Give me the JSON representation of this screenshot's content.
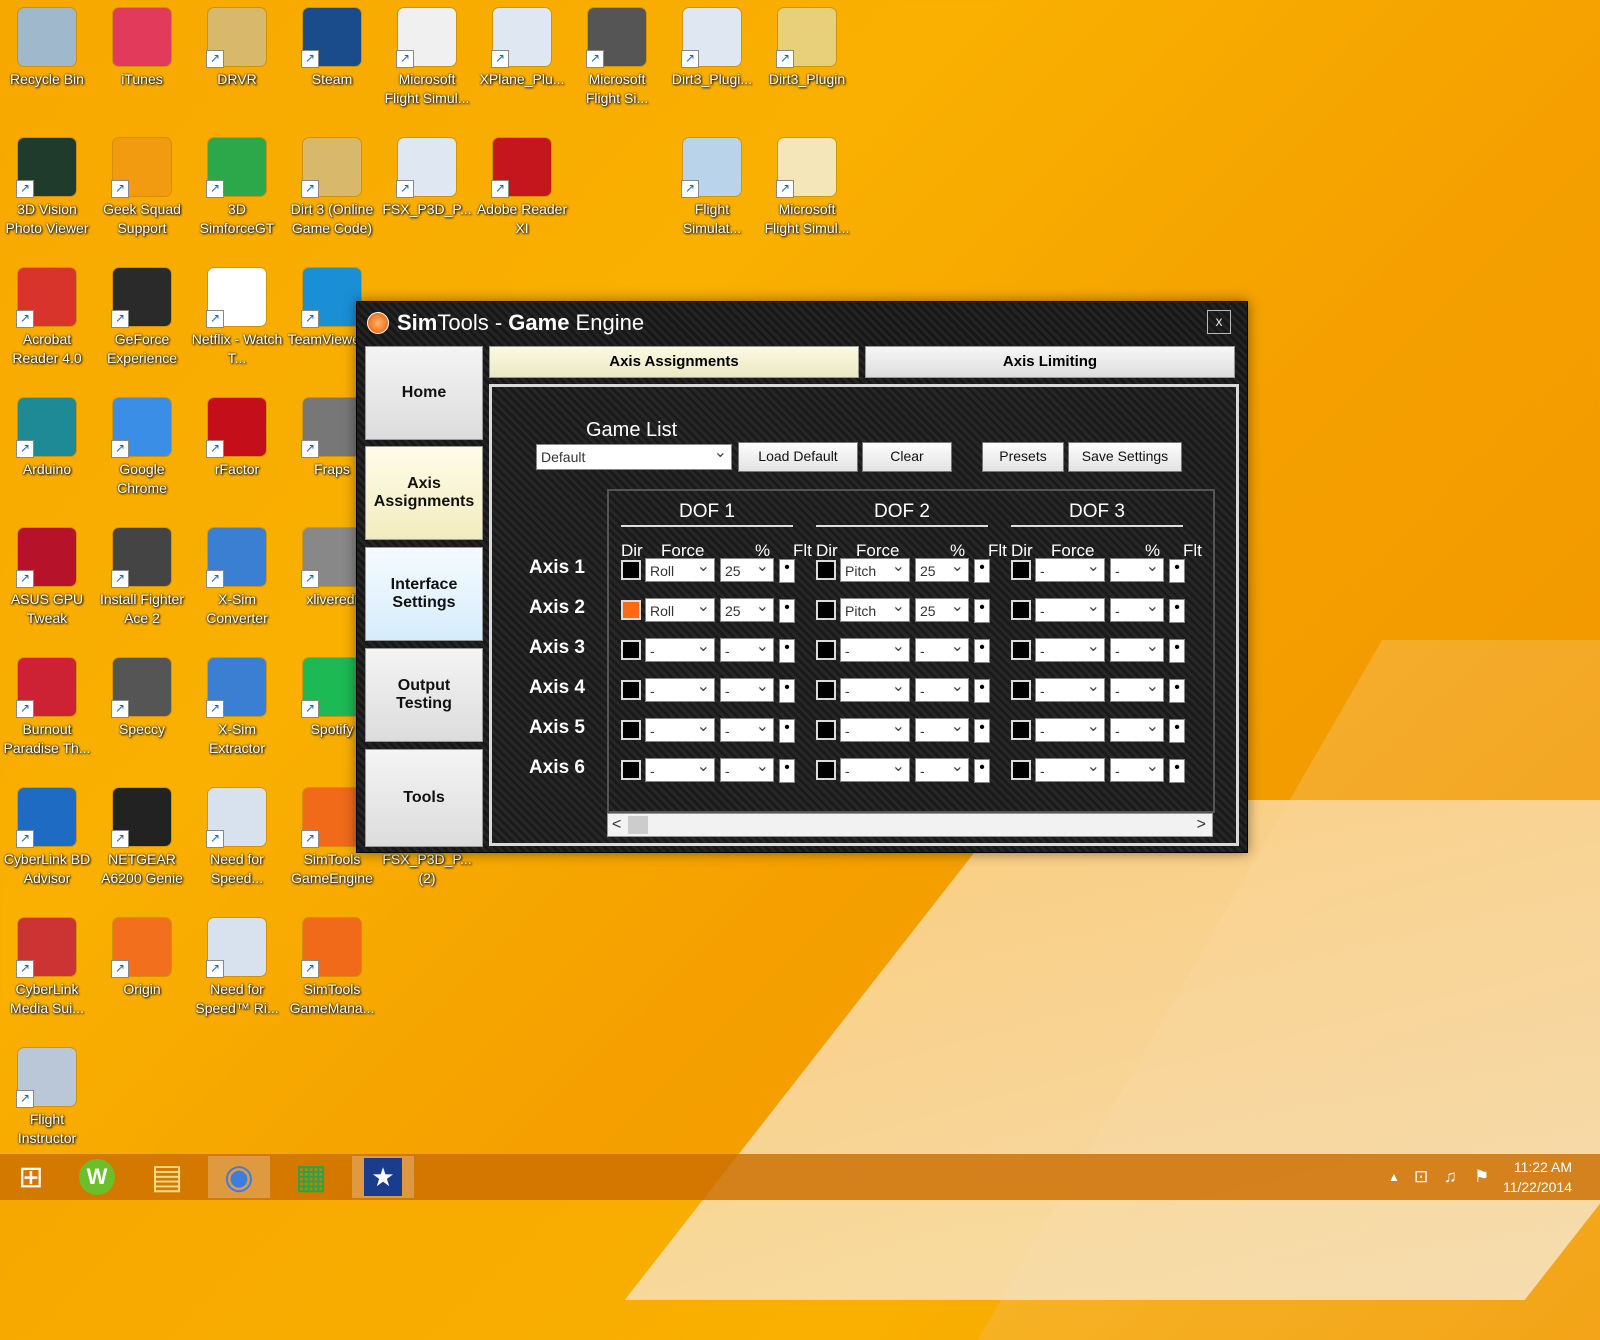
{
  "desktop": {
    "icons": [
      {
        "label": "Recycle Bin"
      },
      {
        "label": "iTunes"
      },
      {
        "label": "DRVR"
      },
      {
        "label": "Steam"
      },
      {
        "label": "Microsoft Flight Simul..."
      },
      {
        "label": "XPlane_Plu..."
      },
      {
        "label": "Microsoft Flight Si..."
      },
      {
        "label": "Dirt3_Plugi..."
      },
      {
        "label": "Dirt3_Plugin"
      },
      {
        "label": "3D Vision Photo Viewer"
      },
      {
        "label": "Geek Squad Support"
      },
      {
        "label": "3D SimforceGT"
      },
      {
        "label": "Dirt 3 (Online Game Code)"
      },
      {
        "label": "FSX_P3D_P..."
      },
      {
        "label": "Adobe Reader XI"
      },
      {
        "label": "Flight Simulat..."
      },
      {
        "label": "Microsoft Flight Simul..."
      },
      {
        "label": "Acrobat Reader 4.0"
      },
      {
        "label": "GeForce Experience"
      },
      {
        "label": "Netflix - Watch T..."
      },
      {
        "label": "TeamViewer 9"
      },
      {
        "label": "Arduino"
      },
      {
        "label": "Google Chrome"
      },
      {
        "label": "rFactor"
      },
      {
        "label": "Fraps"
      },
      {
        "label": "ASUS GPU Tweak"
      },
      {
        "label": "Install Fighter Ace 2"
      },
      {
        "label": "X-Sim Converter"
      },
      {
        "label": "xliveredi"
      },
      {
        "label": "Burnout Paradise Th..."
      },
      {
        "label": "Speccy"
      },
      {
        "label": "X-Sim Extractor"
      },
      {
        "label": "Spotify"
      },
      {
        "label": "CyberLink BD Advisor"
      },
      {
        "label": "NETGEAR A6200 Genie"
      },
      {
        "label": "Need for Speed..."
      },
      {
        "label": "SimTools GameEngine"
      },
      {
        "label": "FSX_P3D_P... (2)"
      },
      {
        "label": "CyberLink Media Sui..."
      },
      {
        "label": "Origin"
      },
      {
        "label": "Need for Speed™ Ri..."
      },
      {
        "label": "SimTools GameMana..."
      },
      {
        "label": "Flight Instructor"
      }
    ]
  },
  "window": {
    "title_part1": "Sim",
    "title_part2": "Tools - ",
    "title_part3": "Game",
    "title_part4": " Engine",
    "close_label": "x",
    "sidebar": {
      "home": "Home",
      "axis_line1": "Axis",
      "axis_line2": "Assignments",
      "iface_line1": "Interface",
      "iface_line2": "Settings",
      "output_line1": "Output",
      "output_line2": "Testing",
      "tools": "Tools"
    },
    "tabs": {
      "axis_assignments": "Axis Assignments",
      "axis_limiting": "Axis Limiting"
    },
    "game_list_label": "Game List",
    "game_select_value": "Default",
    "buttons": {
      "load_default": "Load Default",
      "clear": "Clear",
      "presets": "Presets",
      "save_settings": "Save Settings"
    },
    "dof_titles": [
      "DOF 1",
      "DOF 2",
      "DOF 3"
    ],
    "col_dir": "Dir",
    "col_force": "Force",
    "col_pct": "%",
    "col_flt": "Flt",
    "flt_mark": "•",
    "scroll_left": "<",
    "scroll_right": ">",
    "axes": [
      {
        "label": "Axis 1",
        "dofs": [
          {
            "dir": false,
            "force": "Roll",
            "pct": "25"
          },
          {
            "dir": false,
            "force": "Pitch",
            "pct": "25"
          },
          {
            "dir": false,
            "force": "-",
            "pct": "-"
          }
        ]
      },
      {
        "label": "Axis 2",
        "dofs": [
          {
            "dir": true,
            "force": "Roll",
            "pct": "25"
          },
          {
            "dir": false,
            "force": "Pitch",
            "pct": "25"
          },
          {
            "dir": false,
            "force": "-",
            "pct": "-"
          }
        ]
      },
      {
        "label": "Axis 3",
        "dofs": [
          {
            "dir": false,
            "force": "-",
            "pct": "-"
          },
          {
            "dir": false,
            "force": "-",
            "pct": "-"
          },
          {
            "dir": false,
            "force": "-",
            "pct": "-"
          }
        ]
      },
      {
        "label": "Axis 4",
        "dofs": [
          {
            "dir": false,
            "force": "-",
            "pct": "-"
          },
          {
            "dir": false,
            "force": "-",
            "pct": "-"
          },
          {
            "dir": false,
            "force": "-",
            "pct": "-"
          }
        ]
      },
      {
        "label": "Axis 5",
        "dofs": [
          {
            "dir": false,
            "force": "-",
            "pct": "-"
          },
          {
            "dir": false,
            "force": "-",
            "pct": "-"
          },
          {
            "dir": false,
            "force": "-",
            "pct": "-"
          }
        ]
      },
      {
        "label": "Axis 6",
        "dofs": [
          {
            "dir": false,
            "force": "-",
            "pct": "-"
          },
          {
            "dir": false,
            "force": "-",
            "pct": "-"
          },
          {
            "dir": false,
            "force": "-",
            "pct": "-"
          }
        ]
      }
    ]
  },
  "taskbar": {
    "time": "11:22 AM",
    "date": "11/22/2014",
    "icons": [
      "windows-start-icon",
      "w-app-icon",
      "file-explorer-icon",
      "chrome-icon",
      "store-icon",
      "x-sim-icon"
    ],
    "tray_up_glyph": "▲",
    "tray_network_glyph": "⊡",
    "tray_volume_glyph": "♫",
    "tray_flag_glyph": "⚑",
    "windows_glyph": "⊞",
    "w_glyph": "W",
    "folder_glyph": "▤",
    "chrome_glyph": "◉",
    "store_glyph": "▦",
    "xsim_glyph": "★"
  },
  "colors": {
    "accent_orange": "#ff6a13",
    "desktop_bg": "#f7a800"
  }
}
